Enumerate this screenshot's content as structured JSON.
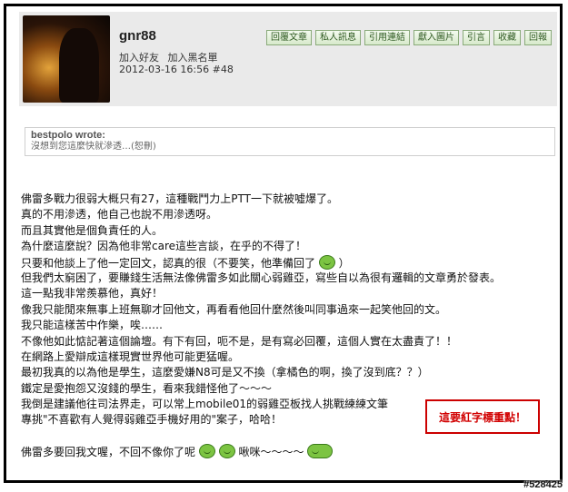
{
  "post": {
    "username": "gnr88",
    "user_actions": [
      "加入好友",
      "加入黑名單"
    ],
    "meta": "2012-03-16 16:56 #48",
    "toolbar": [
      "回覆文章",
      "私人訊息",
      "引用連結",
      "獻入圖片",
      "引言",
      "收藏",
      "回報"
    ]
  },
  "quote": {
    "author": "bestpolo wrote:",
    "text": "沒想到您這麼快就滲透…(恕刪)"
  },
  "body_lines": [
    "佛雷多戰力很弱大概只有27，這種戰鬥力上PTT一下就被噓爆了。",
    "真的不用滲透，他自己也說不用滲透呀。",
    "而且其實他是個負責任的人。",
    "為什麼這麼說？因為他非常care這些言談，在乎的不得了！",
    "只要和他談上了他一定回文，認真的很（不要笑，他準備回了",
    "但我們太窮困了，要賺錢生活無法像佛雷多如此關心弱雞亞，寫些自以為很有邏輯的文章勇於發表。",
    "這一點我非常羨慕他，真好！",
    "像我只能閒來無事上班無聊才回他文，再看看他回什麼然後叫同事過來一起笑他回的文。",
    "我只能這樣苦中作樂，唉……",
    "不像他如此惦記著這個論壇。有下有回，呃不是，是有寫必回覆，這個人實在太盡責了！！",
    "在網路上愛辯成這樣現實世界他可能更猛喔。",
    "最初我真的以為他是學生，這麼愛嫌N8可是又不換（拿橘色的啊，換了沒到底？？）",
    "鐵定是愛抱怨又沒錢的學生，看來我錯怪他了～～～",
    "我倒是建議他往司法界走，可以常上mobile01的弱雞亞板找人挑戰練練文筆",
    "專挑\"不喜歡有人覺得弱雞亞手機好用的\"案子，哈哈！",
    "",
    "佛雷多要回我文喔，不回不像你了呢",
    "啾咪～～～～"
  ],
  "body_suffix": {
    "line5_close": "）"
  },
  "highlight": "這要紅字標重點！",
  "watermark": "#528425",
  "icons": [
    "smile-icon",
    "laugh-icon"
  ],
  "colors": {
    "highlight_border": "#cc0000",
    "highlight_text": "#d10000",
    "toolbar_text": "#2f5a22",
    "header_bg": "#eaeaea"
  }
}
